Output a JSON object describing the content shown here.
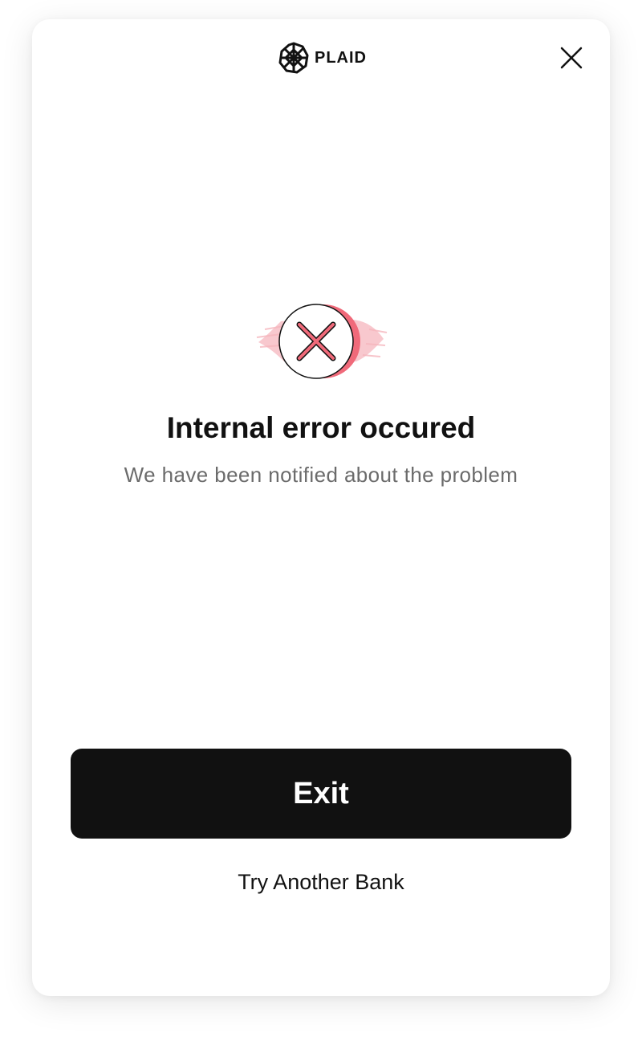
{
  "header": {
    "brand_name": "PLAID",
    "logo_icon": "plaid-logo-icon",
    "close_icon": "close-icon"
  },
  "error": {
    "icon": "error-x-icon",
    "title": "Internal error occured",
    "subtitle": "We have been notified about the problem"
  },
  "actions": {
    "primary_label": "Exit",
    "secondary_label": "Try Another Bank"
  },
  "colors": {
    "primary_button": "#111111",
    "error_accent": "#f06a7a",
    "subtitle_text": "#6b6b6b"
  }
}
